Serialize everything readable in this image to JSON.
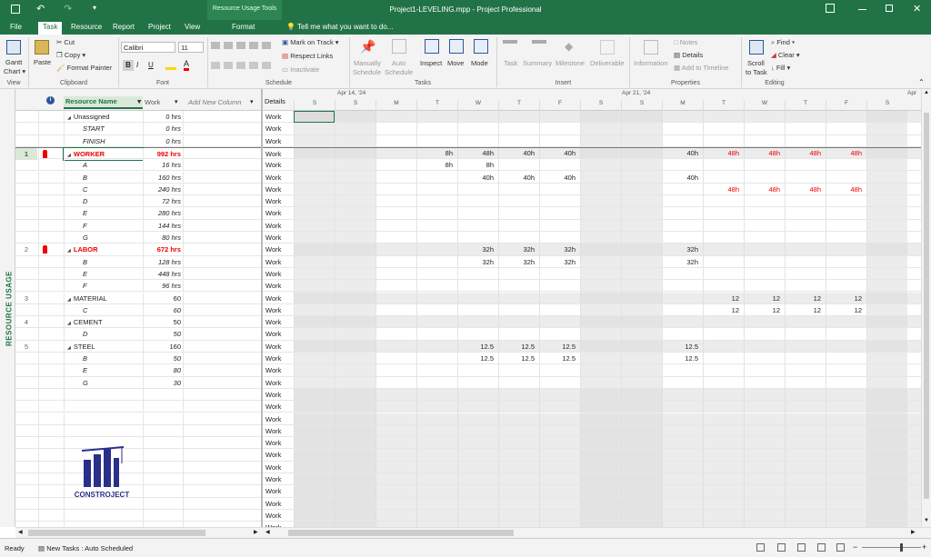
{
  "title": "Project1-LEVELING.mpp - Project Professional",
  "context_tab_header": "Resource Usage Tools",
  "tabs": [
    "File",
    "Task",
    "Resource",
    "Report",
    "Project",
    "View",
    "Format"
  ],
  "tell_me": "Tell me what you want to do...",
  "ribbon": {
    "gantt": "Gantt",
    "chart": "Chart ▾",
    "paste": "Paste",
    "cut": "Cut",
    "copy": "Copy ▾",
    "format_painter": "Format Painter",
    "font_name": "Calibri",
    "font_size": "11",
    "mark_on_track": "Mark on Track ▾",
    "respect_links": "Respect Links",
    "inactivate": "Inactivate",
    "manually": "Manually",
    "schedule": "Schedule",
    "auto": "Auto",
    "auto_schedule": "Schedule",
    "inspect": "Inspect",
    "move": "Move",
    "mode": "Mode",
    "task": "Task",
    "summary": "Summary",
    "milestone": "Milestone",
    "deliverable": "Deliverable",
    "information": "Information",
    "notes": "Notes",
    "details": "Details",
    "add_to_timeline": "Add to Timeline",
    "scroll": "Scroll",
    "to_task": "to Task",
    "find": "Find ▾",
    "clear": "Clear ▾",
    "fill": "Fill ▾",
    "groups": {
      "view": "View",
      "clipboard": "Clipboard",
      "font": "Font",
      "schedule": "Schedule",
      "tasks": "Tasks",
      "insert": "Insert",
      "properties": "Properties",
      "editing": "Editing"
    }
  },
  "side_label": "RESOURCE USAGE",
  "grid_headers": {
    "name": "Resource Name",
    "work": "Work",
    "add": "Add New Column",
    "details": "Details"
  },
  "rows": [
    {
      "id": "",
      "name": "Unassigned",
      "work": "0 hrs",
      "style": "summary"
    },
    {
      "id": "",
      "name": "START",
      "work": "0 hrs",
      "style": "assign"
    },
    {
      "id": "",
      "name": "FINISH",
      "work": "0 hrs",
      "style": "assign"
    },
    {
      "id": "1",
      "name": "WORKER",
      "work": "992 hrs",
      "style": "over"
    },
    {
      "id": "",
      "name": "A",
      "work": "16 hrs",
      "style": "assign"
    },
    {
      "id": "",
      "name": "B",
      "work": "160 hrs",
      "style": "assign"
    },
    {
      "id": "",
      "name": "C",
      "work": "240 hrs",
      "style": "assign"
    },
    {
      "id": "",
      "name": "D",
      "work": "72 hrs",
      "style": "assign"
    },
    {
      "id": "",
      "name": "E",
      "work": "280 hrs",
      "style": "assign"
    },
    {
      "id": "",
      "name": "F",
      "work": "144 hrs",
      "style": "assign"
    },
    {
      "id": "",
      "name": "G",
      "work": "80 hrs",
      "style": "assign"
    },
    {
      "id": "2",
      "name": "LABOR",
      "work": "672 hrs",
      "style": "over"
    },
    {
      "id": "",
      "name": "B",
      "work": "128 hrs",
      "style": "assign"
    },
    {
      "id": "",
      "name": "E",
      "work": "448 hrs",
      "style": "assign"
    },
    {
      "id": "",
      "name": "F",
      "work": "96 hrs",
      "style": "assign"
    },
    {
      "id": "3",
      "name": "MATERIAL",
      "work": "60",
      "style": "summary"
    },
    {
      "id": "",
      "name": "C",
      "work": "60",
      "style": "assign"
    },
    {
      "id": "4",
      "name": "CEMENT",
      "work": "50",
      "style": "summary"
    },
    {
      "id": "",
      "name": "D",
      "work": "50",
      "style": "assign"
    },
    {
      "id": "5",
      "name": "STEEL",
      "work": "160",
      "style": "summary"
    },
    {
      "id": "",
      "name": "B",
      "work": "50",
      "style": "assign"
    },
    {
      "id": "",
      "name": "E",
      "work": "80",
      "style": "assign"
    },
    {
      "id": "",
      "name": "G",
      "work": "30",
      "style": "assign"
    }
  ],
  "detail_label": "Work",
  "timescale": {
    "weeks": [
      "Apr 14, '24",
      "Apr 21, '24",
      "Apr"
    ],
    "days": [
      "S",
      "S",
      "M",
      "T",
      "W",
      "T",
      "F",
      "S",
      "S",
      "M",
      "T",
      "W",
      "T",
      "F",
      "S"
    ]
  },
  "usage": [
    [],
    [],
    [],
    [
      "",
      "",
      "",
      "8h",
      "48h",
      "40h",
      "40h",
      "",
      "",
      "40h",
      "48h",
      "48h",
      "48h",
      "48h",
      ""
    ],
    [
      "",
      "",
      "",
      "8h",
      "8h",
      "",
      "",
      "",
      "",
      "",
      "",
      "",
      "",
      "",
      ""
    ],
    [
      "",
      "",
      "",
      "",
      "40h",
      "40h",
      "40h",
      "",
      "",
      "40h",
      "",
      "",
      "",
      "",
      ""
    ],
    [
      "",
      "",
      "",
      "",
      "",
      "",
      "",
      "",
      "",
      "",
      "48h",
      "48h",
      "48h",
      "48h",
      ""
    ],
    [],
    [],
    [],
    [],
    [
      "",
      "",
      "",
      "",
      "32h",
      "32h",
      "32h",
      "",
      "",
      "32h",
      "",
      "",
      "",
      "",
      ""
    ],
    [
      "",
      "",
      "",
      "",
      "32h",
      "32h",
      "32h",
      "",
      "",
      "32h",
      "",
      "",
      "",
      "",
      ""
    ],
    [],
    [],
    [
      "",
      "",
      "",
      "",
      "",
      "",
      "",
      "",
      "",
      "",
      "12",
      "12",
      "12",
      "12",
      ""
    ],
    [
      "",
      "",
      "",
      "",
      "",
      "",
      "",
      "",
      "",
      "",
      "12",
      "12",
      "12",
      "12",
      ""
    ],
    [],
    [],
    [
      "",
      "",
      "",
      "",
      "12.5",
      "12.5",
      "12.5",
      "",
      "",
      "12.5",
      "",
      "",
      "",
      "",
      ""
    ],
    [
      "",
      "",
      "",
      "",
      "12.5",
      "12.5",
      "12.5",
      "",
      "",
      "12.5",
      "",
      "",
      "",
      "",
      ""
    ],
    [],
    []
  ],
  "logo_text": "CONSTROJECT",
  "status": {
    "ready": "Ready",
    "new_tasks": "New Tasks : Auto Scheduled"
  }
}
